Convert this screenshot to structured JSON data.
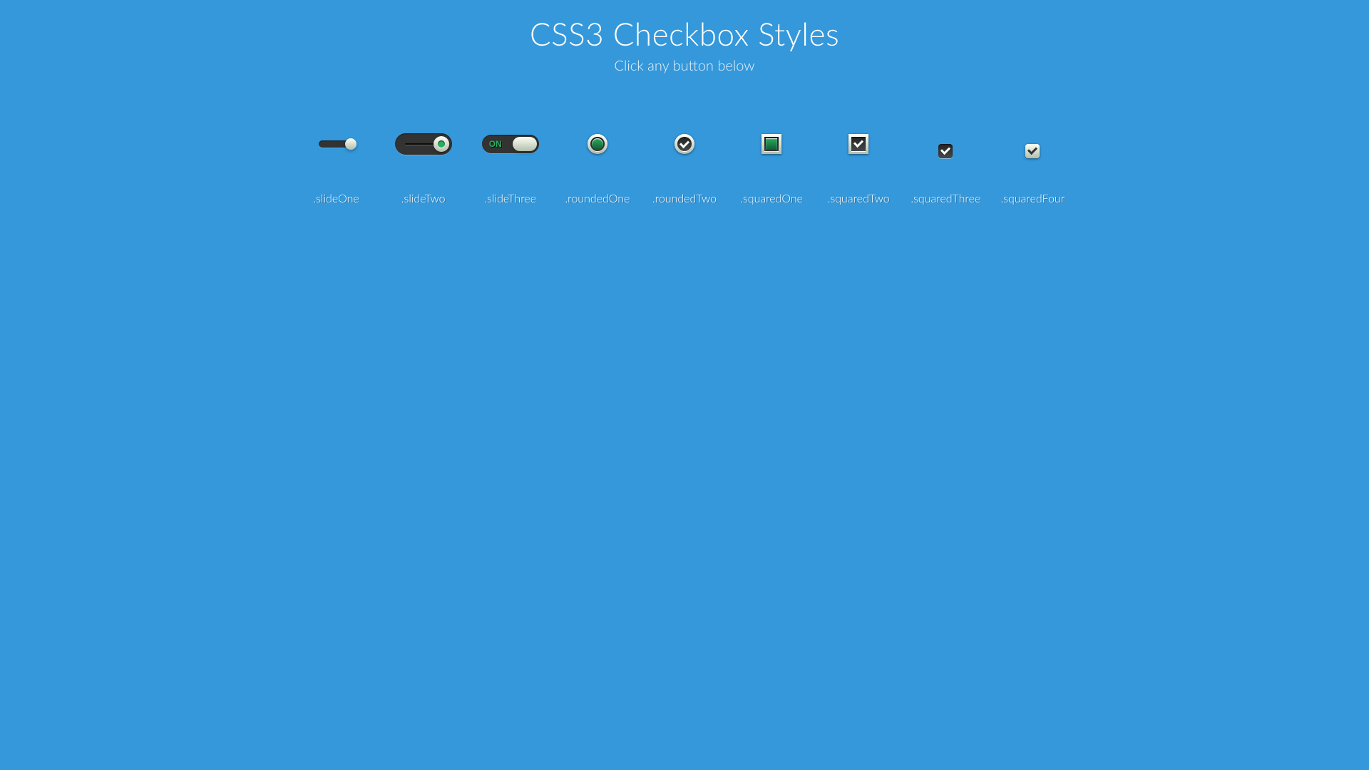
{
  "header": {
    "title": "CSS3 Checkbox Styles",
    "subtitle": "Click any button below"
  },
  "slideThree_on_label": "ON",
  "items": [
    {
      "key": "slideOne",
      "label": ".slideOne",
      "checked": true
    },
    {
      "key": "slideTwo",
      "label": ".slideTwo",
      "checked": true
    },
    {
      "key": "slideThree",
      "label": ".slideThree",
      "checked": true
    },
    {
      "key": "roundedOne",
      "label": ".roundedOne",
      "checked": true
    },
    {
      "key": "roundedTwo",
      "label": ".roundedTwo",
      "checked": true
    },
    {
      "key": "squaredOne",
      "label": ".squaredOne",
      "checked": true
    },
    {
      "key": "squaredTwo",
      "label": ".squaredTwo",
      "checked": true
    },
    {
      "key": "squaredThree",
      "label": ".squaredThree",
      "checked": true
    },
    {
      "key": "squaredFour",
      "label": ".squaredFour",
      "checked": true
    }
  ],
  "colors": {
    "background": "#3498db",
    "accent_green": "#27ae60",
    "dark": "#333333",
    "bevel_light": "#fcfff4"
  }
}
